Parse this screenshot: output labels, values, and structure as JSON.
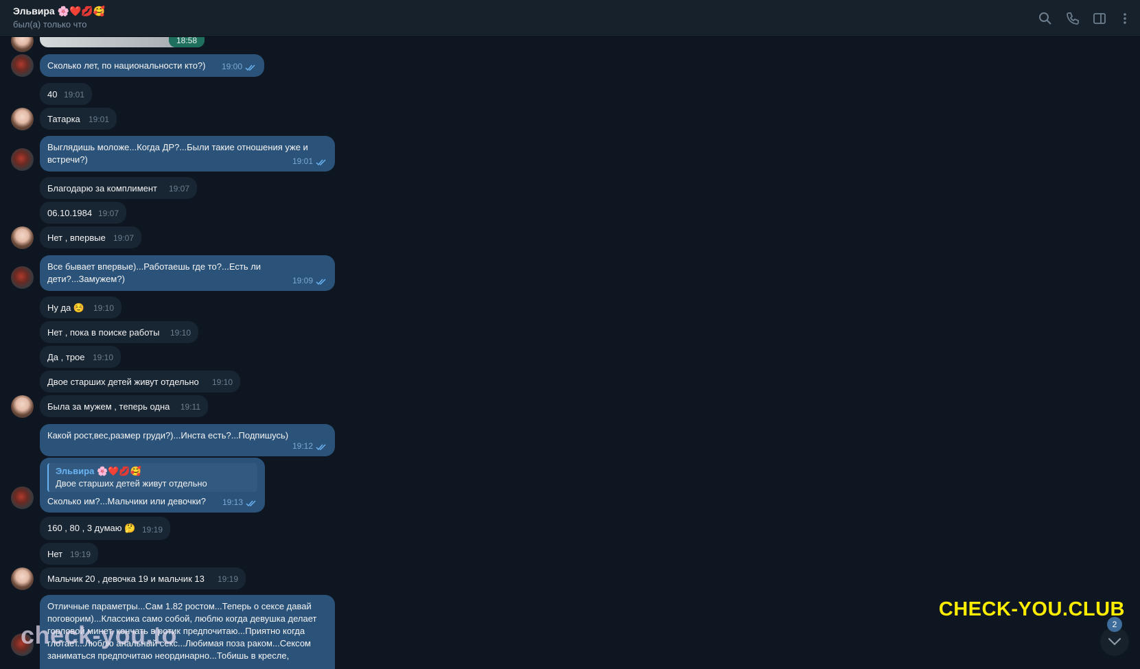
{
  "header": {
    "name": "Эльвира 🌸❤️💋🥰",
    "status": "был(а) только что"
  },
  "icons": [
    "search-icon",
    "phone-icon",
    "sidebar-toggle-icon",
    "more-vert-icon"
  ],
  "colors": {
    "background": "#0e1621",
    "header": "#17212b",
    "incoming_bubble": "#182533",
    "outgoing_bubble": "#2b5278",
    "accent": "#6ab3f3",
    "watermark_yellow": "#ffed00"
  },
  "photo_time": "18:58",
  "messages": [
    {
      "dir": "out",
      "text": "Сколько лет, по национальности кто?)",
      "time": "19:00"
    },
    {
      "dir": "in",
      "text": "40",
      "time": "19:01"
    },
    {
      "dir": "in",
      "text": "Татарка",
      "time": "19:01"
    },
    {
      "dir": "out",
      "text": "Выглядишь моложе...Когда ДР?...Были такие отношения уже и встречи?)",
      "time": "19:01"
    },
    {
      "dir": "in",
      "text": "Благодарю за комплимент",
      "time": "19:07"
    },
    {
      "dir": "in",
      "text": "06.10.1984",
      "time": "19:07"
    },
    {
      "dir": "in",
      "text": "Нет , впервые",
      "time": "19:07"
    },
    {
      "dir": "out",
      "text": "Все бывает впервые)...Работаешь где то?...Есть ли дети?...Замужем?)",
      "time": "19:09"
    },
    {
      "dir": "in",
      "text": "Ну да ☺️",
      "time": "19:10"
    },
    {
      "dir": "in",
      "text": "Нет , пока в поиске работы",
      "time": "19:10"
    },
    {
      "dir": "in",
      "text": "Да , трое",
      "time": "19:10"
    },
    {
      "dir": "in",
      "text": "Двое старших детей живут отдельно",
      "time": "19:10"
    },
    {
      "dir": "in",
      "text": "Была за мужем , теперь одна",
      "time": "19:11"
    },
    {
      "dir": "out",
      "text": "Какой рост,вес,размер груди?)...Инста есть?...Подпишусь)",
      "time": "19:12"
    },
    {
      "dir": "out",
      "reply_name": "Эльвира 🌸❤️💋🥰",
      "reply_text": "Двое старших детей живут отдельно",
      "text": "Сколько им?...Мальчики или девочки?",
      "time": "19:13"
    },
    {
      "dir": "in",
      "text": "160 , 80 , 3 думаю 🤔",
      "time": "19:19"
    },
    {
      "dir": "in",
      "text": "Нет",
      "time": "19:19"
    },
    {
      "dir": "in",
      "text": "Мальчик 20 , девочка 19 и мальчик 13",
      "time": "19:19"
    },
    {
      "dir": "out",
      "text": "Отличные параметры...Сам 1.82 ростом...Теперь о сексе давай поговорим)...Классика само собой, люблю когда девушка делает горловой минет, кончать в ротик предпочитаю...Приятно когда глотает...Люблю анальный секс...Любимая поза раком...Сексом заниматься предпочитаю неординарно...Тобишь в кресле,",
      "time": ""
    }
  ],
  "unread_count": "2",
  "watermarks": {
    "club": "CHECK-YOU.CLUB",
    "to": "check-you.to"
  }
}
